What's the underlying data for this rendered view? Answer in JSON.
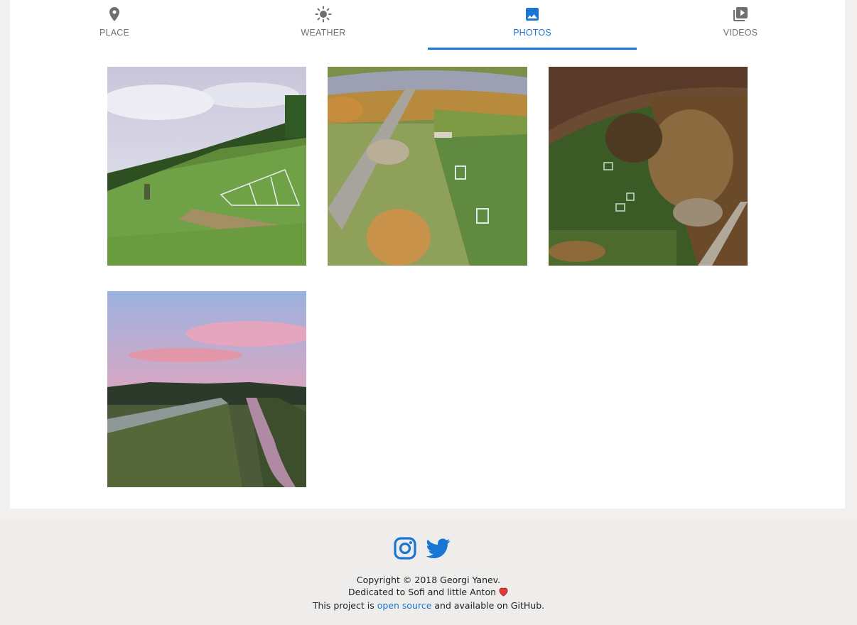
{
  "tabs": [
    {
      "label": "PLACE",
      "icon": "place-pin-icon",
      "active": false
    },
    {
      "label": "WEATHER",
      "icon": "sun-icon",
      "active": false
    },
    {
      "label": "PHOTOS",
      "icon": "image-icon",
      "active": true
    },
    {
      "label": "VIDEOS",
      "icon": "video-library-icon",
      "active": false
    }
  ],
  "colors": {
    "accent": "#1976d2",
    "inactive_tab": "#6f6f6f",
    "page_background": "#f1f0ee",
    "heart": "#e53935"
  },
  "photos": [
    {
      "name": "photo-football-field-low-angle"
    },
    {
      "name": "photo-aerial-field-road"
    },
    {
      "name": "photo-aerial-topdown-field"
    },
    {
      "name": "photo-sunset-river"
    }
  ],
  "footer": {
    "social_icons": [
      "instagram-icon",
      "twitter-icon"
    ],
    "copyright": "Copyright © 2018 Georgi Yanev.",
    "dedication": "Dedicated to Sofi and little Anton",
    "project_prefix": "This project is ",
    "project_link": "open source",
    "project_suffix": " and available on GitHub."
  }
}
